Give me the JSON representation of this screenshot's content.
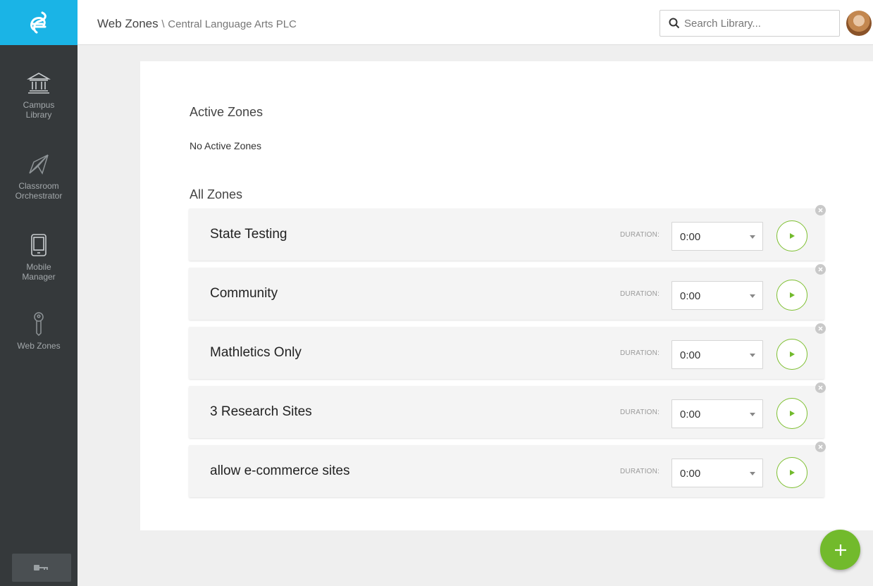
{
  "header": {
    "breadcrumb_main": "Web Zones",
    "breadcrumb_sep": "\\",
    "breadcrumb_sub": "Central Language Arts PLC",
    "search_placeholder": "Search Library..."
  },
  "sidebar": {
    "items": [
      {
        "label_line1": "Campus",
        "label_line2": "Library",
        "icon": "library-icon"
      },
      {
        "label_line1": "Classroom",
        "label_line2": "Orchestrator",
        "icon": "paper-plane-icon"
      },
      {
        "label_line1": "Mobile",
        "label_line2": "Manager",
        "icon": "tablet-icon"
      },
      {
        "label_line1": "Web Zones",
        "label_line2": "",
        "icon": "key-icon"
      }
    ]
  },
  "main": {
    "active_title": "Active Zones",
    "no_active": "No Active Zones",
    "all_title": "All Zones",
    "duration_label": "DURATION:",
    "zones": [
      {
        "name": "State Testing",
        "duration": "0:00"
      },
      {
        "name": "Community",
        "duration": "0:00"
      },
      {
        "name": "Mathletics Only",
        "duration": "0:00"
      },
      {
        "name": "3 Research Sites",
        "duration": "0:00"
      },
      {
        "name": "allow e-commerce sites",
        "duration": "0:00"
      }
    ]
  },
  "colors": {
    "brand_blue": "#1ab4e6",
    "sidebar_bg": "#35393b",
    "accent_green": "#72ba2c"
  }
}
